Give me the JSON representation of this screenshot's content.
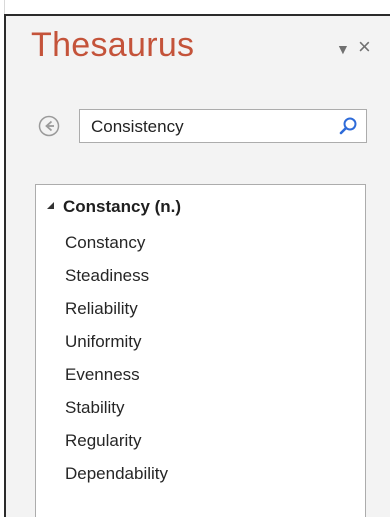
{
  "pane": {
    "title": "Thesaurus",
    "dropdown_glyph": "▼",
    "close_glyph": "×"
  },
  "search": {
    "value": "Consistency",
    "icon": "search-icon"
  },
  "results": {
    "group_label": "Constancy (n.)",
    "items": [
      "Constancy",
      "Steadiness",
      "Reliability",
      "Uniformity",
      "Evenness",
      "Stability",
      "Regularity",
      "Dependability"
    ]
  },
  "colors": {
    "title": "#c4533a",
    "accent_icon": "#2e6bd9",
    "pane_bg": "#f3f3f3"
  }
}
